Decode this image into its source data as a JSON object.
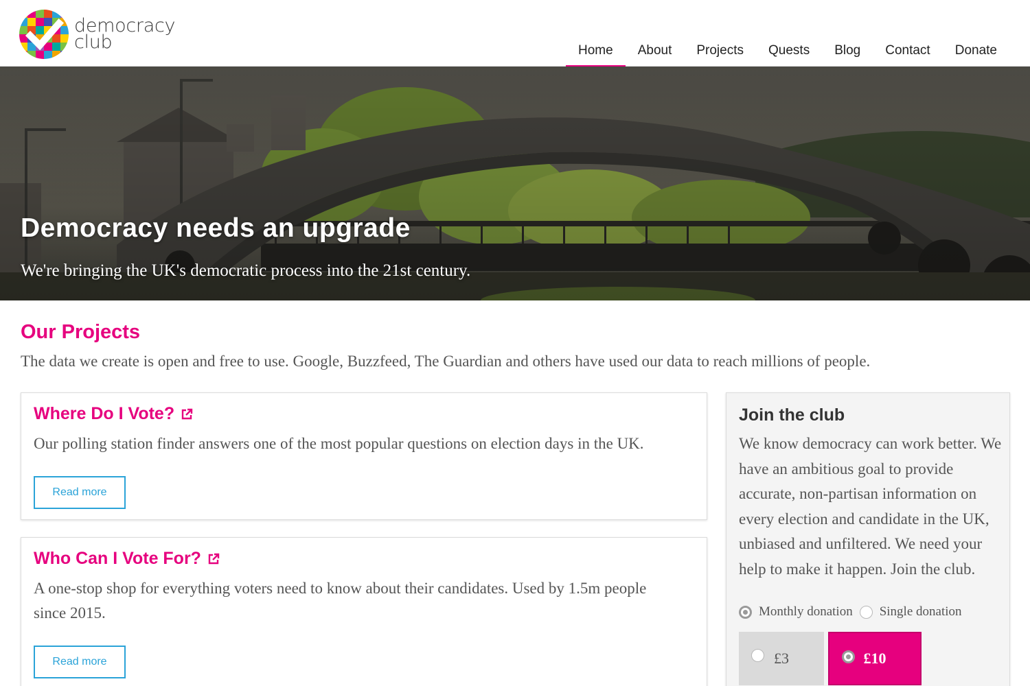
{
  "brand": {
    "name_line1": "democracy",
    "name_line2": "club"
  },
  "nav": {
    "items": [
      "Home",
      "About",
      "Projects",
      "Quests",
      "Blog",
      "Contact",
      "Donate"
    ],
    "active": "Home"
  },
  "hero": {
    "title": "Democracy needs an upgrade",
    "subtitle": "We're bringing the UK's democratic process into the 21st century."
  },
  "projects": {
    "title": "Our Projects",
    "description": "The data we create is open and free to use. Google, Buzzfeed, The Guardian and others have used our data to reach millions of people.",
    "cards": [
      {
        "title": "Where Do I Vote?",
        "body": "Our polling station finder answers one of the most popular questions on election days in the UK.",
        "button": "Read more",
        "icon": "external-link-icon"
      },
      {
        "title": "Who Can I Vote For?",
        "body": "A one-stop shop for everything voters need to know about their candidates. Used by 1.5m people since 2015.",
        "button": "Read more",
        "icon": "external-link-icon"
      }
    ]
  },
  "join": {
    "title": "Join the club",
    "body": "We know democracy can work better. We have an ambitious goal to provide accurate, non-partisan information on every election and candidate in the UK, unbiased and unfiltered. We need your help to make it happen. Join the club.",
    "donation_types": [
      {
        "label": "Monthly donation",
        "selected": true
      },
      {
        "label": "Single donation",
        "selected": false
      }
    ],
    "amounts": [
      {
        "label": "£3",
        "selected": false
      },
      {
        "label": "£10",
        "selected": true
      }
    ]
  },
  "colors": {
    "accent": "#e6007e",
    "button_outline": "#2aa3d8",
    "panel_bg": "#f4f4f4"
  }
}
